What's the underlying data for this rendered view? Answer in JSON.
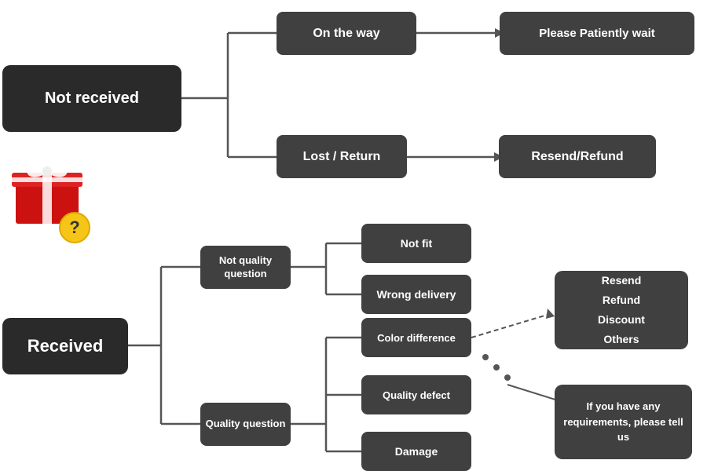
{
  "nodes": {
    "not_received": {
      "label": "Not received"
    },
    "on_the_way": {
      "label": "On the way"
    },
    "please_wait": {
      "label": "Please Patiently wait"
    },
    "lost_return": {
      "label": "Lost / Return"
    },
    "resend_refund_top": {
      "label": "Resend/Refund"
    },
    "received": {
      "label": "Received"
    },
    "not_quality": {
      "label": "Not quality question"
    },
    "not_fit": {
      "label": "Not fit"
    },
    "wrong_delivery": {
      "label": "Wrong delivery"
    },
    "quality_question": {
      "label": "Quality question"
    },
    "color_difference": {
      "label": "Color difference"
    },
    "quality_defect": {
      "label": "Quality defect"
    },
    "damage": {
      "label": "Damage"
    },
    "resend_refund_box": {
      "label": "Resend\nRefund\nDiscount\nOthers"
    },
    "tell_us": {
      "label": "If you have any requirements, please tell us"
    }
  }
}
